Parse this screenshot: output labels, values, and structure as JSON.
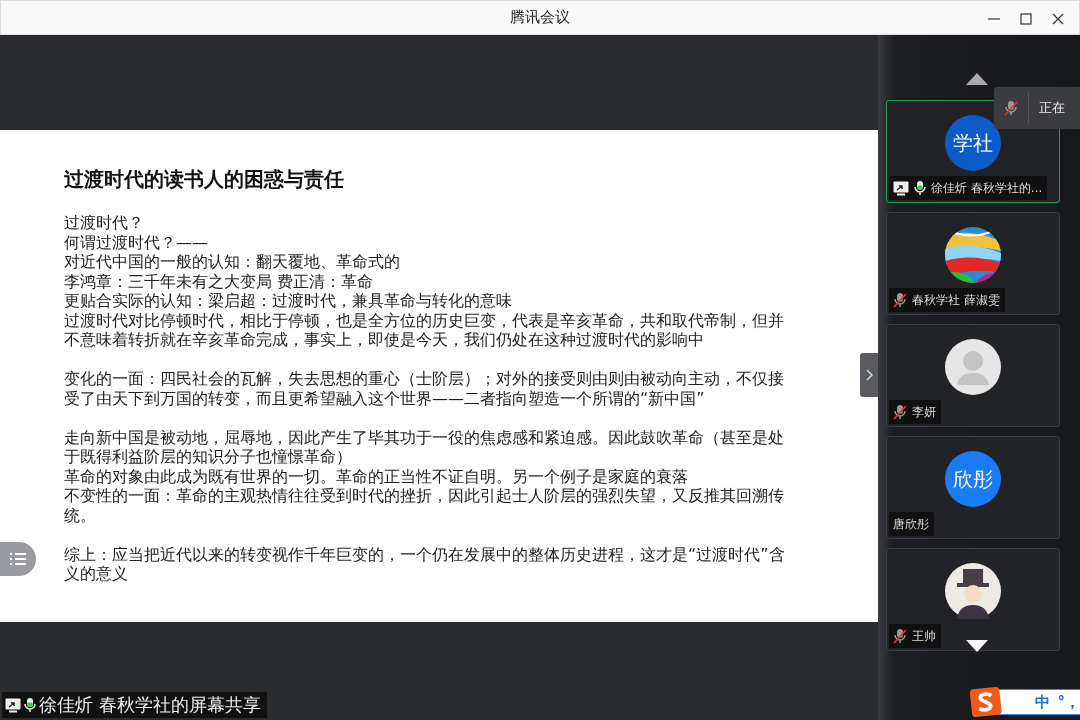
{
  "window": {
    "title": "腾讯会议"
  },
  "slide": {
    "title": "过渡时代的读书人的困惑与责任",
    "groups": [
      [
        "过渡时代？",
        "何谓过渡时代？——",
        "对近代中国的一般的认知：翻天覆地、革命式的",
        "李鸿章：三千年未有之大变局 费正清：革命",
        "更贴合实际的认知：梁启超：过渡时代，兼具革命与转化的意味",
        "过渡时代对比停顿时代，相比于停顿，也是全方位的历史巨变，代表是辛亥革命，共和取代帝制，但并不意味着转折就在辛亥革命完成，事实上，即使是今天，我们仍处在这种过渡时代的影响中"
      ],
      [
        "变化的一面：四民社会的瓦解，失去思想的重心（士阶层）；对外的接受则由则由被动向主动，不仅接受了由天下到万国的转变，而且更希望融入这个世界——二者指向塑造一个所谓的“新中国”"
      ],
      [
        "走向新中国是被动地，屈辱地，因此产生了毕其功于一役的焦虑感和紧迫感。因此鼓吹革命（甚至是处于既得利益阶层的知识分子也憧憬革命）",
        "革命的对象由此成为既有世界的一切。革命的正当性不证自明。另一个例子是家庭的衰落",
        "不变性的一面：革命的主观热情往往受到时代的挫折，因此引起士人阶层的强烈失望，又反推其回溯传统。"
      ],
      [
        "综上：应当把近代以来的转变视作千年巨变的，一个仍在发展中的整体历史进程，这才是“过渡时代”含义的意义"
      ]
    ]
  },
  "share_caption": {
    "text": "徐佳炘 春秋学社的屏幕共享",
    "mic": {
      "kind": "on"
    },
    "sharing": true
  },
  "participants": [
    {
      "name": "徐佳炘 春秋学社的...",
      "avatar": {
        "kind": "text",
        "text": "学社",
        "color": "#0d5bc6"
      },
      "mic": {
        "kind": "on"
      },
      "sharing": true,
      "selected": true
    },
    {
      "name": "春秋学社 薛淑雯",
      "mic": {
        "kind": "muted"
      },
      "sharing": false,
      "selected": false
    },
    {
      "name": "李妍",
      "avatar": {
        "kind": "silhouette"
      },
      "mic": {
        "kind": "muted"
      },
      "sharing": false,
      "selected": false
    },
    {
      "name": "唐欣彤",
      "avatar": {
        "kind": "text",
        "text": "欣彤",
        "color": "#1a7cf5"
      },
      "sharing": false,
      "selected": false
    },
    {
      "name": "王帅",
      "avatar": {
        "kind": "figure"
      },
      "mic": {
        "kind": "muted"
      },
      "sharing": false,
      "selected": false
    }
  ],
  "speaking_tooltip": {
    "text": "正在"
  },
  "ime_bar": {
    "mode": "中",
    "punctuation": "°，"
  }
}
